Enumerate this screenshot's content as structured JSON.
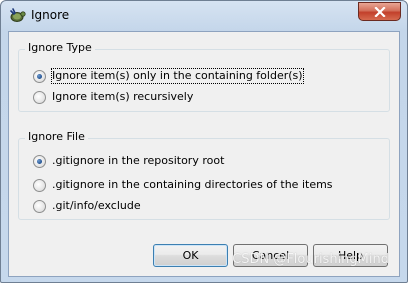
{
  "window": {
    "title": "Ignore",
    "icon": "tortoise-icon",
    "close_icon": "close-icon"
  },
  "ignore_type": {
    "title": "Ignore Type",
    "options": [
      {
        "label": "Ignore item(s) only in the containing folder(s)",
        "checked": true
      },
      {
        "label": "Ignore item(s) recursively",
        "checked": false
      }
    ]
  },
  "ignore_file": {
    "title": "Ignore File",
    "options": [
      {
        "label": ".gitignore in the repository root",
        "checked": true
      },
      {
        "label": ".gitignore in the containing directories of the items",
        "checked": false
      },
      {
        "label": ".git/info/exclude",
        "checked": false
      }
    ]
  },
  "buttons": {
    "ok": "OK",
    "cancel": "Cancel",
    "help": "Help"
  },
  "watermark": "CSDN @FlourishingMind",
  "colors": {
    "titlebar": "#c4d6ea",
    "dialog_bg": "#f0f0f0",
    "close_button": "#c2402b",
    "default_button_border": "#3c7fb1"
  }
}
